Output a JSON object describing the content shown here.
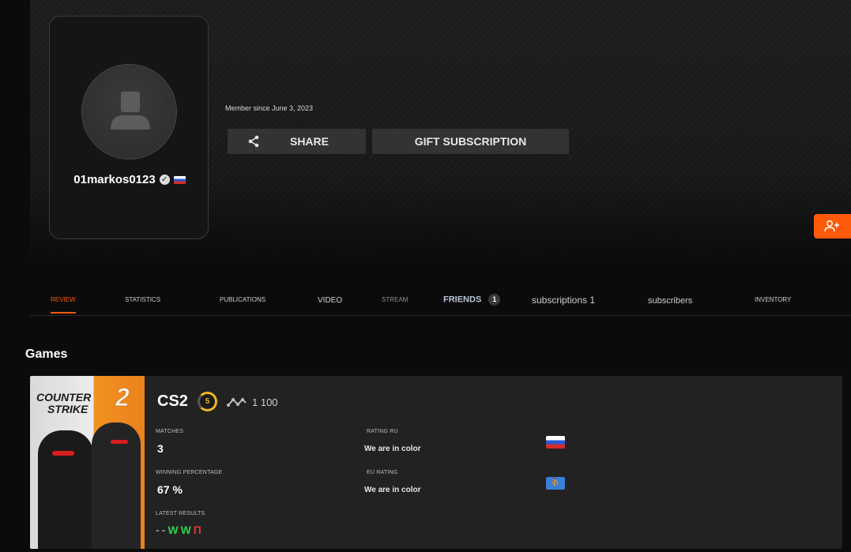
{
  "profile": {
    "username": "01markos0123",
    "member_since": "Member since June 3, 2023",
    "share_label": "SHARE",
    "gift_label": "GIFT SUBSCRIPTION"
  },
  "tabs": [
    {
      "label": "REVIEW",
      "active": true
    },
    {
      "label": "STATISTICS"
    },
    {
      "label": "PUBLICATIONS"
    },
    {
      "label": "VIDEO"
    },
    {
      "label": "STREAM"
    },
    {
      "label": "FRIENDS",
      "badge": "1"
    },
    {
      "label": "subscriptions 1"
    },
    {
      "label": "subscribers"
    },
    {
      "label": "INVENTORY"
    }
  ],
  "games_title": "Games",
  "game": {
    "art_logo_line1": "COUNTER",
    "art_logo_line2": "STRIKE",
    "art_logo_num": "2",
    "title": "CS2",
    "level": "5",
    "elo": "1 100",
    "matches_label": "MATCHES",
    "matches_value": "3",
    "win_label": "WINNING PERCENTAGE",
    "win_value": "67 %",
    "results_label": "LATEST RESULTS",
    "results": [
      "-",
      "-",
      "W",
      "W",
      "П"
    ],
    "rating_ru_label": "RATING RU",
    "rating_ru_value": "We are in color",
    "eu_label": "EU RATING",
    "eu_value": "We are in color"
  },
  "colors": {
    "accent": "#ff5a0a",
    "win": "#2fcf4f",
    "loss": "#e43535",
    "level_ring": "#f0b71a"
  }
}
